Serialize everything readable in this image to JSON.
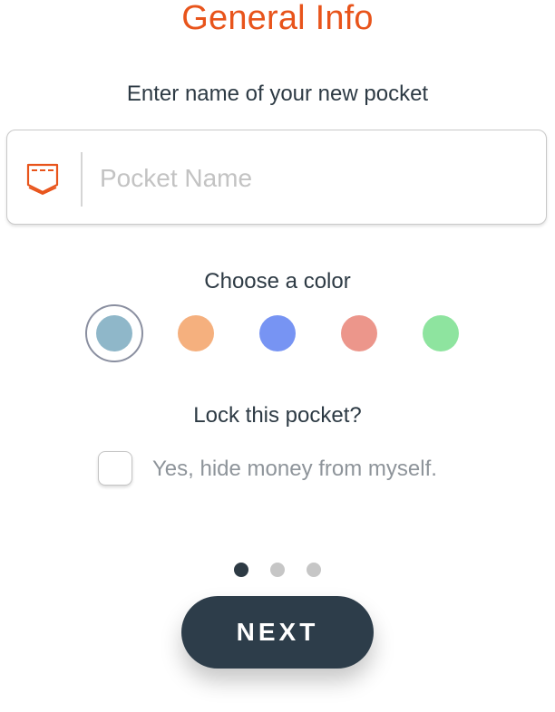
{
  "header": {
    "title": "General Info"
  },
  "name_section": {
    "label": "Enter name of your new pocket",
    "icon": "pocket-icon",
    "input_value": "",
    "placeholder": "Pocket Name"
  },
  "color_section": {
    "label": "Choose a color",
    "selected_index": 0,
    "colors": [
      {
        "name": "color-blue-grey",
        "hex": "#8fb7c9"
      },
      {
        "name": "color-orange",
        "hex": "#f5b07e"
      },
      {
        "name": "color-blue",
        "hex": "#7794f3"
      },
      {
        "name": "color-red",
        "hex": "#ec968b"
      },
      {
        "name": "color-green",
        "hex": "#8ee49f"
      }
    ]
  },
  "lock_section": {
    "label": "Lock this pocket?",
    "checkbox_label": "Yes, hide money from myself.",
    "checked": false
  },
  "pagination": {
    "current": 1,
    "total": 3,
    "active_color": "#2d3a44",
    "inactive_color": "#c6c6c6"
  },
  "footer": {
    "next_label": "NEXT"
  },
  "theme": {
    "accent": "#e8541b",
    "primary_dark": "#2d3d4a"
  }
}
